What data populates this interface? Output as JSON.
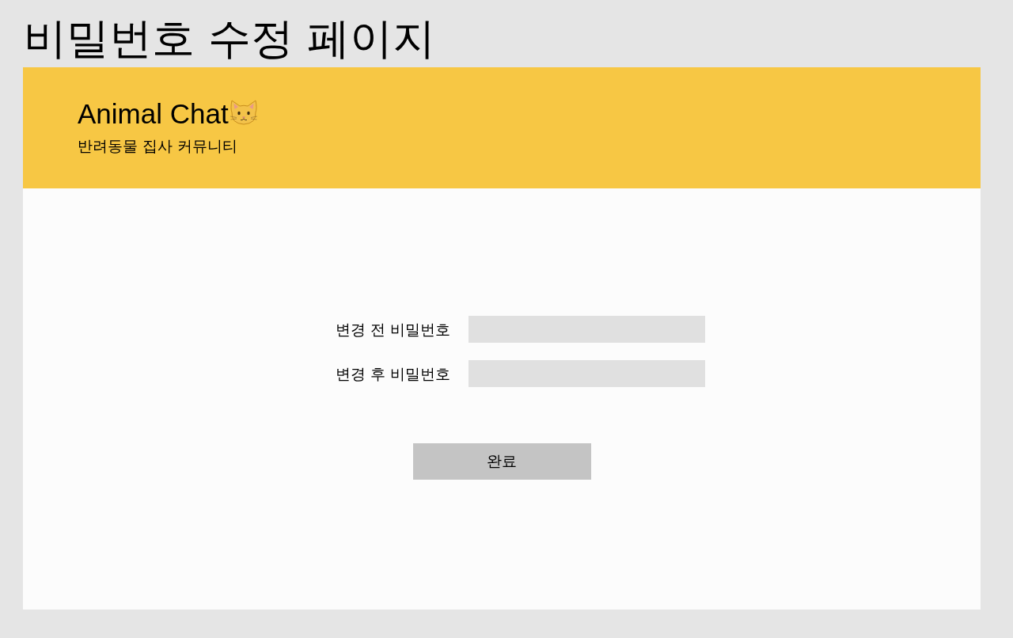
{
  "page_title": "비밀번호 수정 페이지",
  "header": {
    "logo": "Animal Chat",
    "tagline": "반려동물 집사 커뮤니티"
  },
  "form": {
    "fields": [
      {
        "label": "변경 전 비밀번호"
      },
      {
        "label": "변경 후 비밀번호"
      }
    ],
    "submit_button": "완료"
  }
}
